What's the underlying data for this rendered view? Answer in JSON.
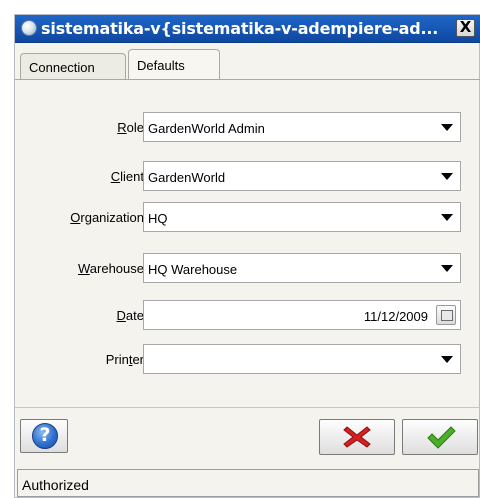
{
  "window": {
    "title": "sistematika-v{sistematika-v-adempiere-ad...",
    "close_label": "X"
  },
  "tabs": [
    {
      "label": "Connection",
      "selected": false
    },
    {
      "label": "Defaults",
      "selected": true
    }
  ],
  "fields": {
    "role": {
      "mnemonic": "R",
      "label_rest": "ole",
      "value": "GardenWorld Admin"
    },
    "client": {
      "mnemonic": "C",
      "label_rest": "lient",
      "value": "GardenWorld"
    },
    "organization": {
      "mnemonic": "O",
      "label_rest": "rganization",
      "value": "HQ"
    },
    "warehouse": {
      "mnemonic": "W",
      "label_rest": "arehouse",
      "value": "HQ Warehouse"
    },
    "date": {
      "mnemonic": "D",
      "label_rest": "ate",
      "value": "11/12/2009"
    },
    "printer": {
      "label_start": "Prin",
      "mnemonic": "t",
      "label_end": "er",
      "value": ""
    }
  },
  "buttons": {
    "help_glyph": "?",
    "help_icon": "help-circle-icon",
    "cancel_icon": "red-x-icon",
    "ok_icon": "green-check-icon",
    "cancel_color": "#d32020",
    "ok_color": "#4caf2a"
  },
  "status": {
    "text": "Authorized"
  },
  "colors": {
    "titlebar": "#1656b2",
    "window_bg": "#f4f3ee"
  }
}
